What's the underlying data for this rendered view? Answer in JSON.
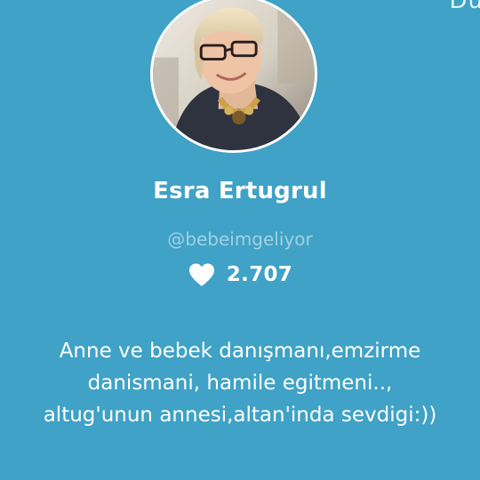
{
  "header": {
    "corner_text": "Du"
  },
  "profile": {
    "name": "Esra Ertugrul",
    "username": "@bebeimgeliyor",
    "likes_count": "2.707",
    "like_icon": "heart-icon",
    "bio_lines": [
      "Anne ve bebek danışmanı,emzirme",
      "danismani, hamile egitmeni..,",
      "altug'unun annesi,altan'inda sevdigi:))"
    ]
  },
  "colors": {
    "background": "#3fa2c6",
    "text": "#ffffff",
    "username": "#9fd1e3",
    "avatar_border": "#ffffff"
  }
}
